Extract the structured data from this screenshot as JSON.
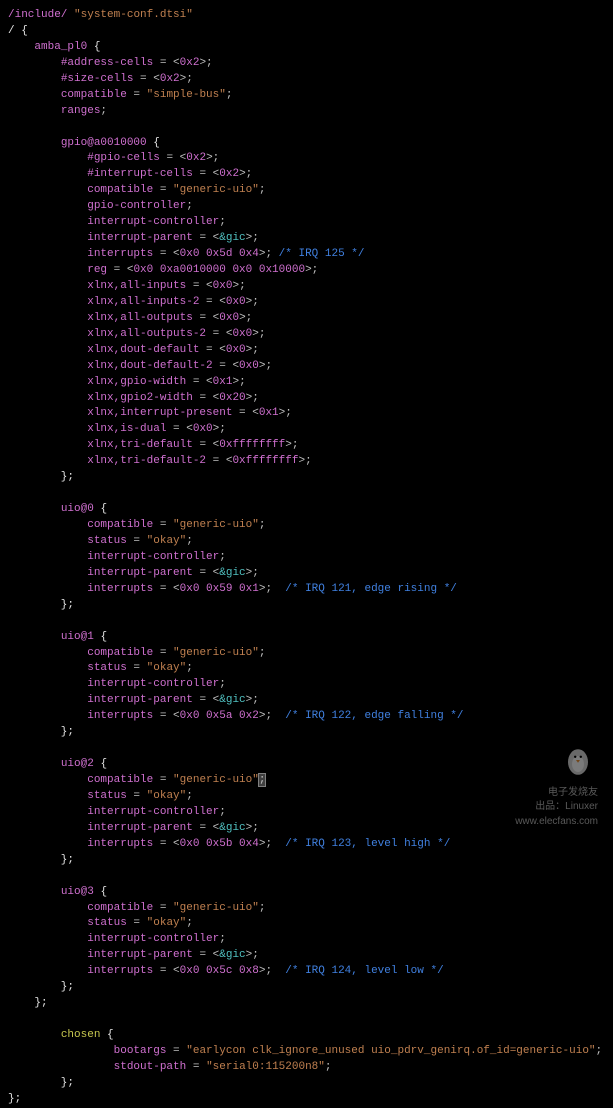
{
  "source": {
    "include_directive": "/include/",
    "include_file": "\"system-conf.dtsi\"",
    "root_open": "/ {",
    "amba_pl0": "    amba_pl0 {",
    "address_cells": "        #address-cells = <0x2>;",
    "size_cells": "        #size-cells = <0x2>;",
    "compatible_sb": "        compatible = \"simple-bus\";",
    "ranges": "        ranges;",
    "gpio_open": "        gpio@a0010000 {",
    "gpio_gpio_cells": "            #gpio-cells = <0x2>;",
    "gpio_int_cells": "            #interrupt-cells = <0x2>;",
    "gpio_compat": "            compatible = \"generic-uio\";",
    "gpio_controller": "            gpio-controller;",
    "gpio_int_controller": "            interrupt-controller;",
    "gpio_int_parent": "            interrupt-parent = <&gic>;",
    "gpio_interrupts": "            interrupts = <0x0 0x5d 0x4>; /* IRQ 125 */",
    "gpio_reg": "            reg = <0x0 0xa0010000 0x0 0x10000>;",
    "gpio_all_inputs": "            xlnx,all-inputs = <0x0>;",
    "gpio_all_inputs2": "            xlnx,all-inputs-2 = <0x0>;",
    "gpio_all_outputs": "            xlnx,all-outputs = <0x0>;",
    "gpio_all_outputs2": "            xlnx,all-outputs-2 = <0x0>;",
    "gpio_dout_def": "            xlnx,dout-default = <0x0>;",
    "gpio_dout_def2": "            xlnx,dout-default-2 = <0x0>;",
    "gpio_width": "            xlnx,gpio-width = <0x1>;",
    "gpio_width2": "            xlnx,gpio2-width = <0x20>;",
    "gpio_int_present": "            xlnx,interrupt-present = <0x1>;",
    "gpio_is_dual": "            xlnx,is-dual = <0x0>;",
    "gpio_tri_def": "            xlnx,tri-default = <0xffffffff>;",
    "gpio_tri_def2": "            xlnx,tri-default-2 = <0xffffffff>;",
    "gpio_close": "        };",
    "uio0_open": "        uio@0 {",
    "uio0_compat": "            compatible = \"generic-uio\";",
    "uio0_status": "            status = \"okay\";",
    "uio0_intctrl": "            interrupt-controller;",
    "uio0_intparent": "            interrupt-parent = <&gic>;",
    "uio0_interrupts": "            interrupts = <0x0 0x59 0x1>;  /* IRQ 121, edge rising */",
    "uio0_close": "        };",
    "uio1_open": "        uio@1 {",
    "uio1_compat": "            compatible = \"generic-uio\";",
    "uio1_status": "            status = \"okay\";",
    "uio1_intctrl": "            interrupt-controller;",
    "uio1_intparent": "            interrupt-parent = <&gic>;",
    "uio1_interrupts": "            interrupts = <0x0 0x5a 0x2>;  /* IRQ 122, edge falling */",
    "uio1_close": "        };",
    "uio2_open": "        uio@2 {",
    "uio2_compat": "            compatible = \"generic-uio\";",
    "uio2_status": "            status = \"okay\";",
    "uio2_intctrl": "            interrupt-controller;",
    "uio2_intparent": "            interrupt-parent = <&gic>;",
    "uio2_interrupts": "            interrupts = <0x0 0x5b 0x4>;  /* IRQ 123, level high */",
    "uio2_close": "        };",
    "uio3_open": "        uio@3 {",
    "uio3_compat": "            compatible = \"generic-uio\";",
    "uio3_status": "            status = \"okay\";",
    "uio3_intctrl": "            interrupt-controller;",
    "uio3_intparent": "            interrupt-parent = <&gic>;",
    "uio3_interrupts": "            interrupts = <0x0 0x5c 0x8>;  /* IRQ 124, level low */",
    "uio3_close": "        };",
    "amba_close": "    };",
    "chosen_open": "        chosen {",
    "chosen_bootargs": "                bootargs = \"earlycon clk_ignore_unused uio_pdrv_genirq.of_id=generic-uio\";",
    "chosen_stdout": "                stdout-path = \"serial0:115200n8\";",
    "chosen_close": "        };",
    "root_close": "};"
  },
  "watermark": {
    "text1": "电子发烧友",
    "text2": "出品：Linuxer",
    "site": "www.elecfans.com"
  }
}
